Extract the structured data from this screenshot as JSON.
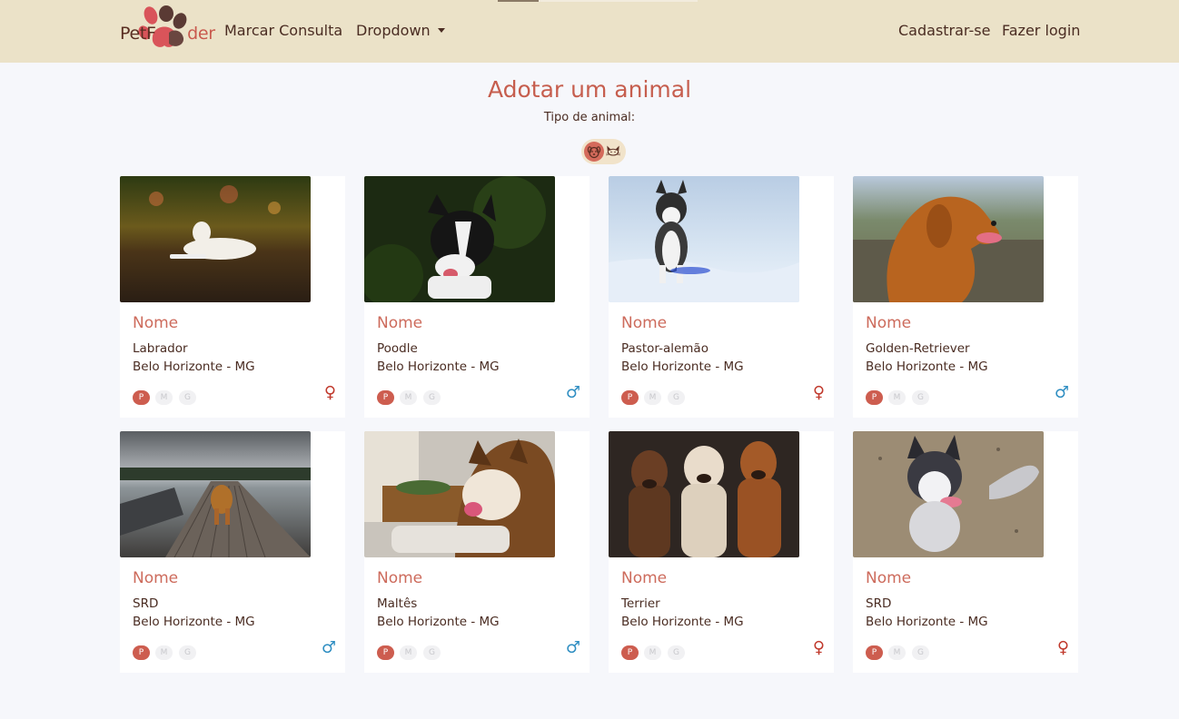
{
  "nav": {
    "brand_left": "PetF",
    "brand_right": "der",
    "links": [
      "Marcar Consulta",
      "Dropdown"
    ],
    "right_links": [
      "Cadastrar-se",
      "Fazer login"
    ]
  },
  "page": {
    "title": "Adotar um animal",
    "subtitle": "Tipo de animal:",
    "type_options": [
      "dog-icon",
      "cat-icon"
    ],
    "type_selected": "dog-icon"
  },
  "sizes": [
    "P",
    "M",
    "G"
  ],
  "cards": [
    {
      "name": "Nome",
      "breed": "Labrador",
      "city": "Belo Horizonte - MG",
      "size": "P",
      "gender": "♀"
    },
    {
      "name": "Nome",
      "breed": "Poodle",
      "city": "Belo Horizonte - MG",
      "size": "P",
      "gender": "♂"
    },
    {
      "name": "Nome",
      "breed": "Pastor-alemão",
      "city": "Belo Horizonte - MG",
      "size": "P",
      "gender": "♀"
    },
    {
      "name": "Nome",
      "breed": "Golden-Retriever",
      "city": "Belo Horizonte - MG",
      "size": "P",
      "gender": "♂"
    },
    {
      "name": "Nome",
      "breed": "SRD",
      "city": "Belo Horizonte - MG",
      "size": "P",
      "gender": "♂"
    },
    {
      "name": "Nome",
      "breed": "Maltês",
      "city": "Belo Horizonte - MG",
      "size": "P",
      "gender": "♂"
    },
    {
      "name": "Nome",
      "breed": "Terrier",
      "city": "Belo Horizonte - MG",
      "size": "P",
      "gender": "♀"
    },
    {
      "name": "Nome",
      "breed": "SRD",
      "city": "Belo Horizonte - MG",
      "size": "P",
      "gender": "♀"
    }
  ],
  "colors": {
    "navbar_bg": "#ebe2c8",
    "accent": "#c65e4e",
    "female": "#c0382b",
    "male": "#2f8ec2"
  }
}
